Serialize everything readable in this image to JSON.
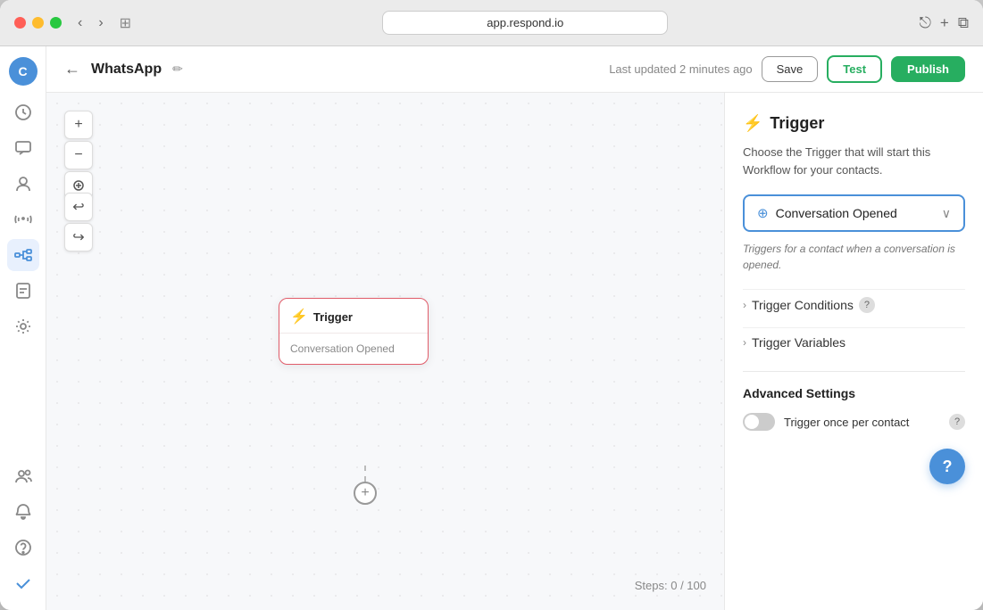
{
  "browser": {
    "url": "app.respond.io",
    "traffic_lights": [
      "red",
      "yellow",
      "green"
    ]
  },
  "top_bar": {
    "title": "WhatsApp",
    "last_updated": "Last updated 2 minutes ago",
    "save_label": "Save",
    "test_label": "Test",
    "publish_label": "Publish"
  },
  "nav": {
    "avatar_label": "C",
    "items": [
      {
        "id": "dashboard",
        "icon": "⊙"
      },
      {
        "id": "chat",
        "icon": "☐"
      },
      {
        "id": "contacts",
        "icon": "👤"
      },
      {
        "id": "broadcast",
        "icon": "◎"
      },
      {
        "id": "workflow",
        "icon": "⊞",
        "active": true
      },
      {
        "id": "reports",
        "icon": "▦"
      },
      {
        "id": "settings",
        "icon": "⚙"
      }
    ],
    "bottom_items": [
      {
        "id": "team",
        "icon": "👥"
      },
      {
        "id": "notifications",
        "icon": "🔔"
      },
      {
        "id": "help",
        "icon": "?"
      },
      {
        "id": "checkmark",
        "icon": "✓"
      }
    ]
  },
  "canvas": {
    "zoom_in": "+",
    "zoom_out": "−",
    "crosshair": "⊕",
    "undo": "↩",
    "redo": "↪",
    "node": {
      "title": "Trigger",
      "subtitle": "Conversation Opened"
    },
    "steps": "Steps: 0 / 100"
  },
  "right_panel": {
    "section_title": "Trigger",
    "description": "Choose the Trigger that will start this Workflow for your contacts.",
    "dropdown": {
      "label": "Conversation Opened",
      "chevron": "∨"
    },
    "trigger_description": "Triggers for a contact when a conversation is opened.",
    "conditions_label": "Trigger Conditions",
    "variables_label": "Trigger Variables",
    "advanced": {
      "title": "Advanced Settings",
      "toggle_label": "Trigger once per contact",
      "help_tooltip": "?"
    },
    "help_btn": "?"
  }
}
